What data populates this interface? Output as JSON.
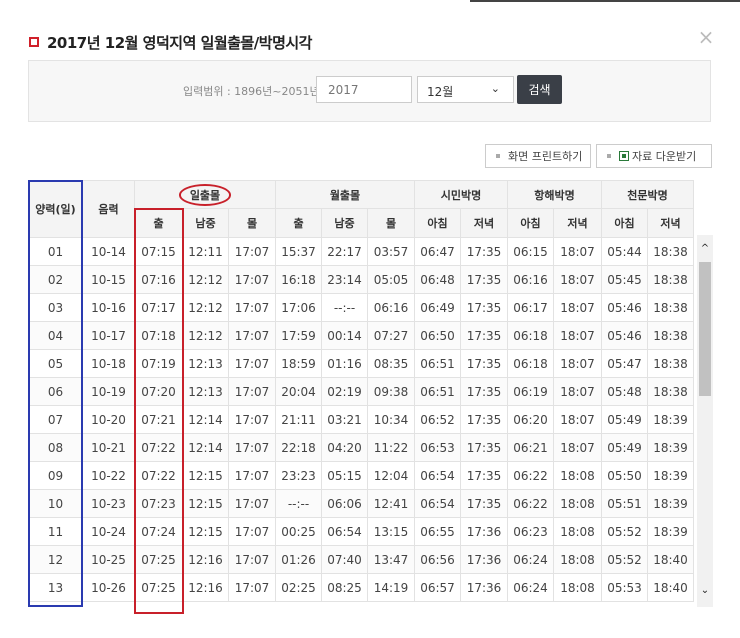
{
  "dialog": {
    "title": "2017년 12월 영덕지역 일월출몰/박명시각",
    "close_symbol": "×"
  },
  "search": {
    "range_label": "입력범위 : 1896년~2051년",
    "year_value": "2017",
    "month_value": "12월",
    "search_label": "검색"
  },
  "actions": {
    "print_label": "화면 프린트하기",
    "download_label": "자료 다운받기"
  },
  "table": {
    "group_headers": {
      "solar": "양력(일)",
      "lunar": "음력",
      "sun": "일출몰",
      "moon": "월출몰",
      "civil": "시민박명",
      "nautical": "항해박명",
      "astronomical": "천문박명"
    },
    "sub_headers": [
      "출",
      "남중",
      "몰",
      "출",
      "남중",
      "몰",
      "아침",
      "저녁",
      "아침",
      "저녁",
      "아침",
      "저녁"
    ],
    "rows": [
      [
        "01",
        "10-14",
        "07:15",
        "12:11",
        "17:07",
        "15:37",
        "22:17",
        "03:57",
        "06:47",
        "17:35",
        "06:15",
        "18:07",
        "05:44",
        "18:38"
      ],
      [
        "02",
        "10-15",
        "07:16",
        "12:12",
        "17:07",
        "16:18",
        "23:14",
        "05:05",
        "06:48",
        "17:35",
        "06:16",
        "18:07",
        "05:45",
        "18:38"
      ],
      [
        "03",
        "10-16",
        "07:17",
        "12:12",
        "17:07",
        "17:06",
        "--:--",
        "06:16",
        "06:49",
        "17:35",
        "06:17",
        "18:07",
        "05:46",
        "18:38"
      ],
      [
        "04",
        "10-17",
        "07:18",
        "12:12",
        "17:07",
        "17:59",
        "00:14",
        "07:27",
        "06:50",
        "17:35",
        "06:18",
        "18:07",
        "05:46",
        "18:38"
      ],
      [
        "05",
        "10-18",
        "07:19",
        "12:13",
        "17:07",
        "18:59",
        "01:16",
        "08:35",
        "06:51",
        "17:35",
        "06:18",
        "18:07",
        "05:47",
        "18:38"
      ],
      [
        "06",
        "10-19",
        "07:20",
        "12:13",
        "17:07",
        "20:04",
        "02:19",
        "09:38",
        "06:51",
        "17:35",
        "06:19",
        "18:07",
        "05:48",
        "18:38"
      ],
      [
        "07",
        "10-20",
        "07:21",
        "12:14",
        "17:07",
        "21:11",
        "03:21",
        "10:34",
        "06:52",
        "17:35",
        "06:20",
        "18:07",
        "05:49",
        "18:39"
      ],
      [
        "08",
        "10-21",
        "07:22",
        "12:14",
        "17:07",
        "22:18",
        "04:20",
        "11:22",
        "06:53",
        "17:35",
        "06:21",
        "18:07",
        "05:49",
        "18:39"
      ],
      [
        "09",
        "10-22",
        "07:22",
        "12:15",
        "17:07",
        "23:23",
        "05:15",
        "12:04",
        "06:54",
        "17:35",
        "06:22",
        "18:08",
        "05:50",
        "18:39"
      ],
      [
        "10",
        "10-23",
        "07:23",
        "12:15",
        "17:07",
        "--:--",
        "06:06",
        "12:41",
        "06:54",
        "17:35",
        "06:22",
        "18:08",
        "05:51",
        "18:39"
      ],
      [
        "11",
        "10-24",
        "07:24",
        "12:15",
        "17:07",
        "00:25",
        "06:54",
        "13:15",
        "06:55",
        "17:36",
        "06:23",
        "18:08",
        "05:52",
        "18:39"
      ],
      [
        "12",
        "10-25",
        "07:25",
        "12:16",
        "17:07",
        "01:26",
        "07:40",
        "13:47",
        "06:56",
        "17:36",
        "06:24",
        "18:08",
        "05:52",
        "18:40"
      ],
      [
        "13",
        "10-26",
        "07:25",
        "12:16",
        "17:07",
        "02:25",
        "08:25",
        "14:19",
        "06:57",
        "17:36",
        "06:24",
        "18:08",
        "05:53",
        "18:40"
      ]
    ]
  },
  "scrollbar": {
    "up_symbol": "^",
    "down_symbol": "⌄"
  },
  "colors": {
    "accent_red": "#c8202a",
    "annotation_blue": "#2a3ab0",
    "button_dark": "#3a3f47"
  }
}
